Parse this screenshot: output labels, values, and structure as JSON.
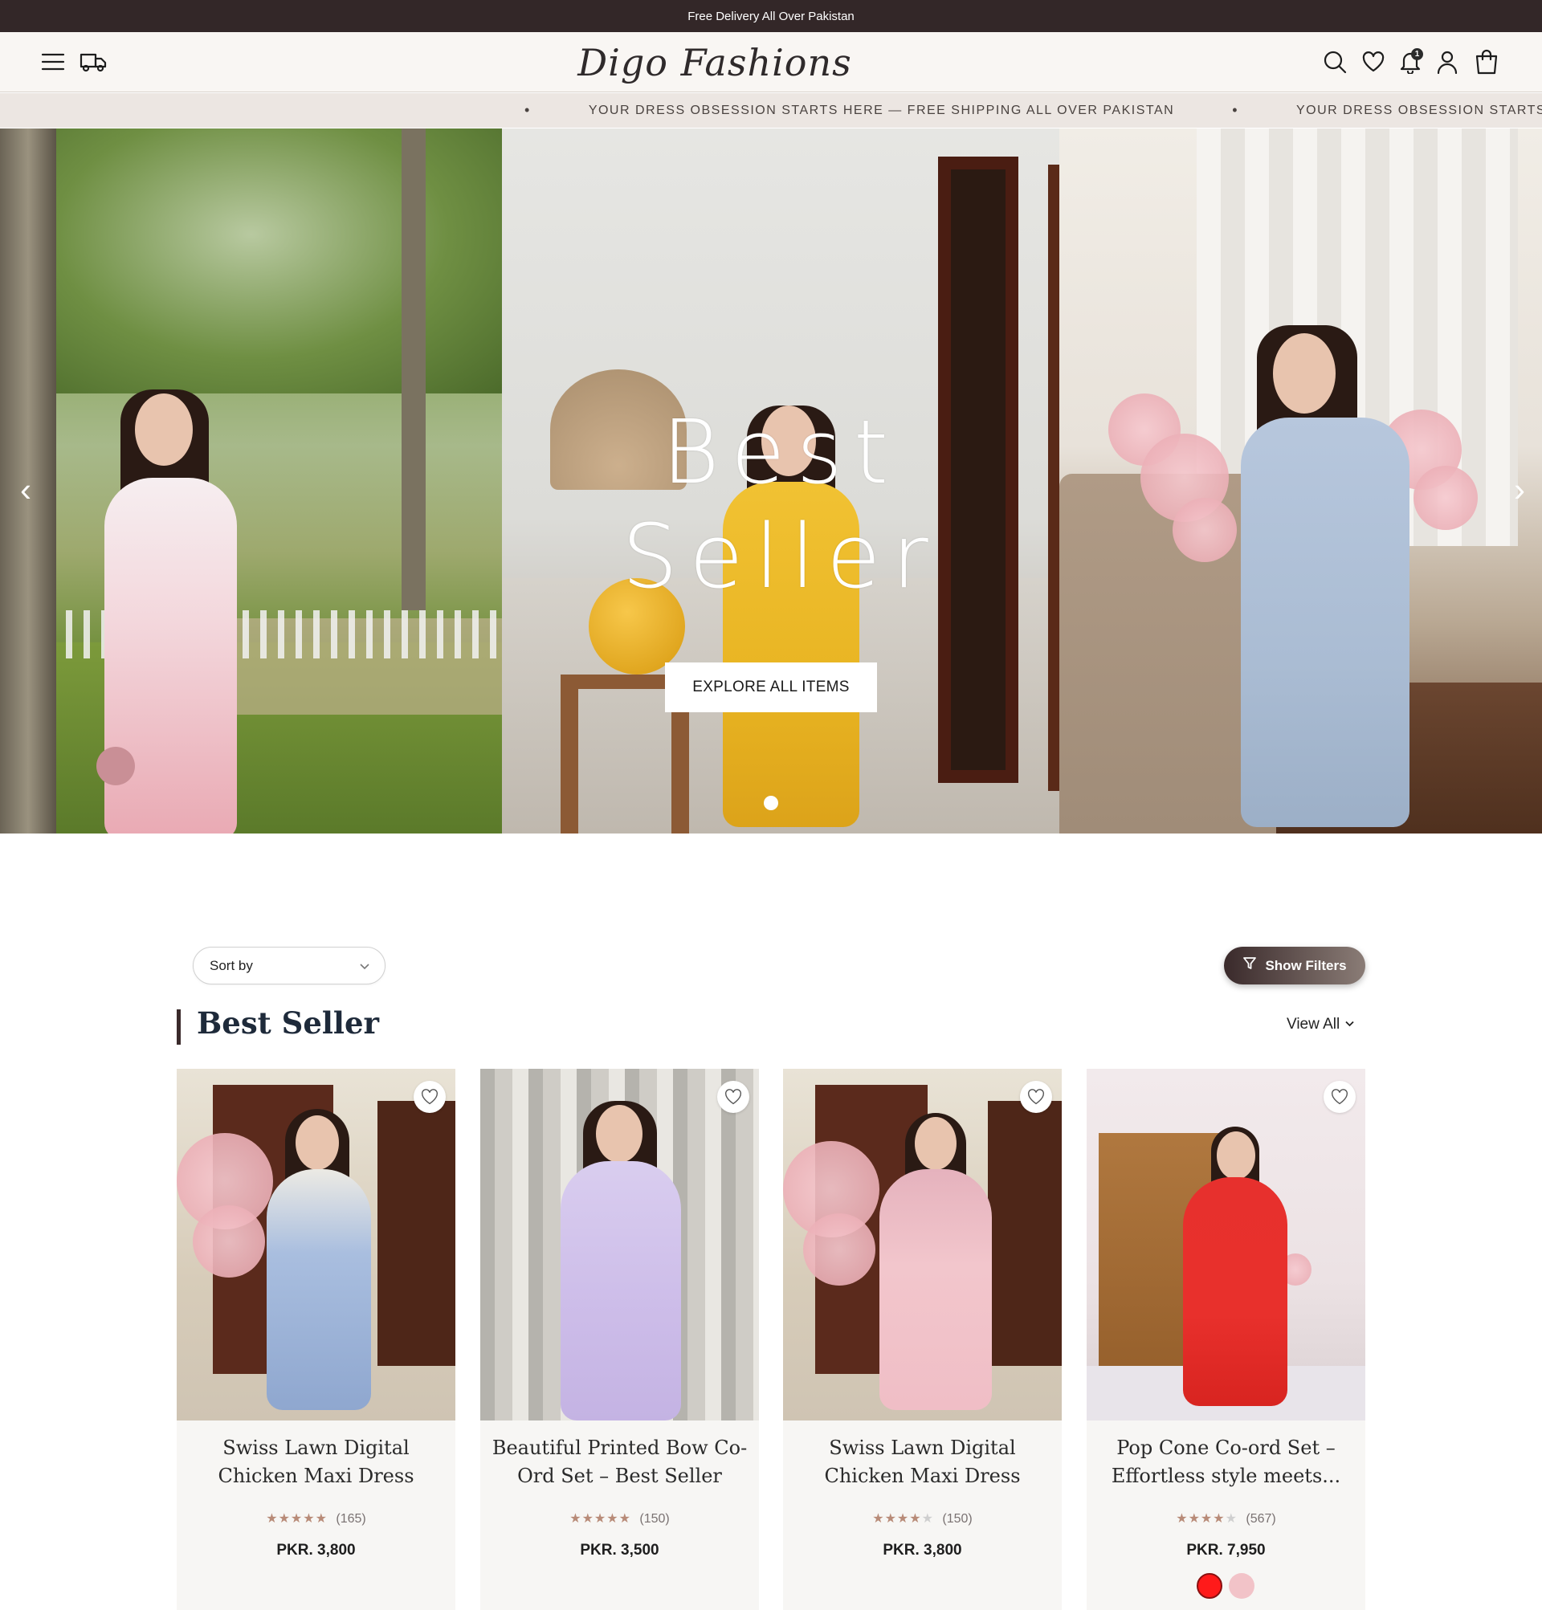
{
  "announcement": "Free Delivery All Over Pakistan",
  "header": {
    "logo": "Digo Fashions",
    "notification_count": "1",
    "icons": [
      "menu-icon",
      "truck-icon",
      "search-icon",
      "heart-icon",
      "bell-icon",
      "user-icon",
      "cart-icon"
    ]
  },
  "marquee": {
    "dot": "•",
    "text": "YOUR DRESS OBSESSION STARTS HERE — FREE SHIPPING ALL OVER PAKISTAN",
    "text_repeat": "YOUR DRESS OBSESSION STARTS HERE — FREE SHIP"
  },
  "hero": {
    "title": "Best Seller",
    "button": "EXPLORE ALL ITEMS",
    "prev_arrow": "‹",
    "next_arrow": "›",
    "slide_count": 1,
    "active_slide": 1
  },
  "listing": {
    "sort_label": "Sort by",
    "filters_label": "Show Filters",
    "section_title": "Best Seller",
    "view_all": "View All"
  },
  "products": [
    {
      "title": "Swiss Lawn Digital Chicken Maxi Dress",
      "rating": 5,
      "reviews": "(165)",
      "price": "PKR. 3,800",
      "colors": []
    },
    {
      "title": "Beautiful Printed Bow Co-Ord Set – Best Seller",
      "rating": 5,
      "reviews": "(150)",
      "price": "PKR. 3,500",
      "colors": []
    },
    {
      "title": "Swiss Lawn Digital Chicken Maxi Dress",
      "rating": 4,
      "reviews": "(150)",
      "price": "PKR. 3,800",
      "colors": []
    },
    {
      "title": "Pop Cone Co-ord Set – Effortless style meets...",
      "rating": 4,
      "reviews": "(567)",
      "price": "PKR. 7,950",
      "colors": [
        "#ff1a1a",
        "#f2c3c8"
      ]
    }
  ],
  "colors": {
    "announcement_bg": "#332728",
    "header_bg": "#f9f6f3",
    "marquee_bg": "#ece6e2",
    "accent": "#3a2a2b",
    "star": "#b88b78",
    "card_bg": "#f7f6f4"
  }
}
